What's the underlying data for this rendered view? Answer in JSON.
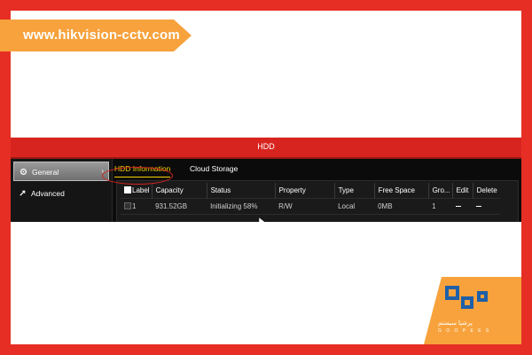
{
  "banner": {
    "url_text": "www.hikvision-cctv.com"
  },
  "dvr": {
    "window_title": "HDD",
    "sidebar": {
      "items": [
        {
          "label": "General",
          "active": true
        },
        {
          "label": "Advanced",
          "active": false
        }
      ]
    },
    "tabs": [
      {
        "label": "HDD Information",
        "active": true
      },
      {
        "label": "Cloud Storage",
        "active": false
      }
    ],
    "table": {
      "columns": [
        "Label",
        "Capacity",
        "Status",
        "Property",
        "Type",
        "Free Space",
        "Gro...",
        "Edit",
        "Delete"
      ],
      "rows": [
        {
          "label": "1",
          "capacity": "931.52GB",
          "status": "Initializing 58%",
          "property": "R/W",
          "type": "Local",
          "free_space": "0MB",
          "group": "1"
        }
      ]
    },
    "colors": {
      "title_bar": "#d8241f",
      "active_tab": "#f5d300",
      "highlight_ring": "#d8241f"
    }
  },
  "logo": {
    "text_line": "پرشیا سیستم",
    "sub_line": "G O O P E E S"
  }
}
